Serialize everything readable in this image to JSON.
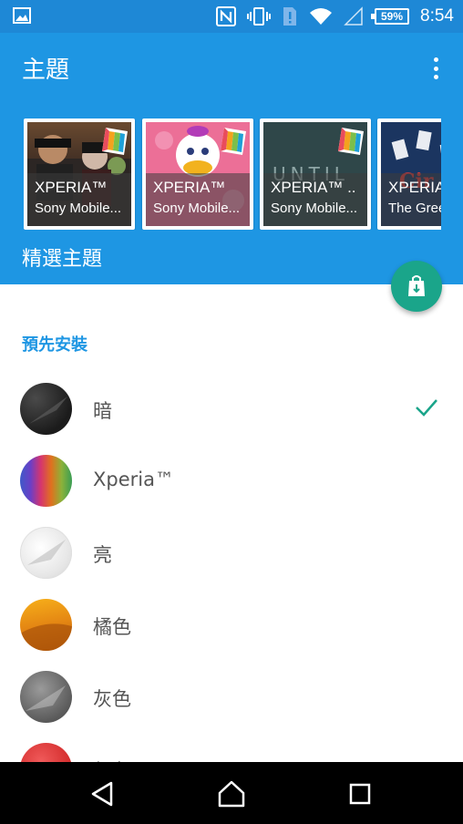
{
  "status_bar": {
    "time": "8:54",
    "battery_percent": "59%",
    "icons": [
      "image-icon",
      "nfc-icon",
      "vibrate-icon",
      "sim-alert-icon",
      "wifi-icon",
      "signal-icon",
      "battery-icon"
    ]
  },
  "app_bar": {
    "title": "主題",
    "menu_icon": "overflow-menu-icon"
  },
  "featured": {
    "title": "精選主題",
    "cards": [
      {
        "title": "XPERIA™",
        "subtitle": "Sony Mobile..."
      },
      {
        "title": "XPERIA™",
        "subtitle": "Sony Mobile..."
      },
      {
        "title": "XPERIA™ ..",
        "subtitle": "Sony Mobile..."
      },
      {
        "title": "XPERIA",
        "subtitle": "The Gree"
      }
    ]
  },
  "fab_icon": "store-bag-icon",
  "preinstalled": {
    "header": "預先安裝",
    "items": [
      {
        "label": "暗",
        "selected": true
      },
      {
        "label": "Xperia™",
        "selected": false
      },
      {
        "label": "亮",
        "selected": false
      },
      {
        "label": "橘色",
        "selected": false
      },
      {
        "label": "灰色",
        "selected": false
      },
      {
        "label": "紅色",
        "selected": false
      }
    ]
  },
  "colors": {
    "primary": "#1e96e3",
    "status_bar": "#1e88d6",
    "accent": "#1aa58a"
  },
  "nav_bar": {
    "icons": [
      "back-icon",
      "home-icon",
      "recents-icon"
    ]
  }
}
